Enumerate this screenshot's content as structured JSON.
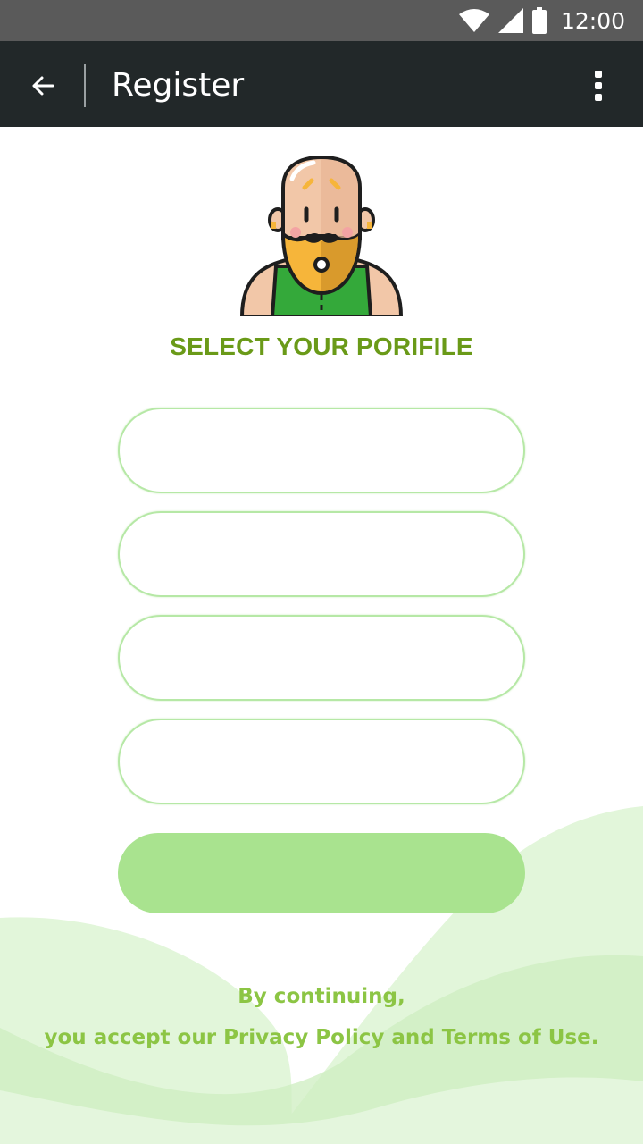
{
  "status_bar": {
    "time": "12:00",
    "icons": [
      "wifi-icon",
      "cell-signal-icon",
      "battery-icon"
    ]
  },
  "app_bar": {
    "title": "Register",
    "back_icon": "arrow-left-icon",
    "menu_icon": "more-vertical-icon"
  },
  "profile": {
    "heading": "SELECT YOUR PORIFILE",
    "avatar": "bald-bearded-man-avatar"
  },
  "form": {
    "fields": [
      {
        "value": "",
        "placeholder": ""
      },
      {
        "value": "",
        "placeholder": ""
      },
      {
        "value": "",
        "placeholder": ""
      },
      {
        "value": "",
        "placeholder": ""
      }
    ],
    "submit_label": ""
  },
  "footer": {
    "line1": "By continuing,",
    "line2": "you accept our Privacy Policy and Terms of Use."
  },
  "colors": {
    "accent": "#6a9a18",
    "field_border": "#b6e8a6",
    "button": "#a9e38f",
    "footer_text": "#8cc544",
    "app_bar": "#222829",
    "status_bar": "#5a5a5a"
  }
}
